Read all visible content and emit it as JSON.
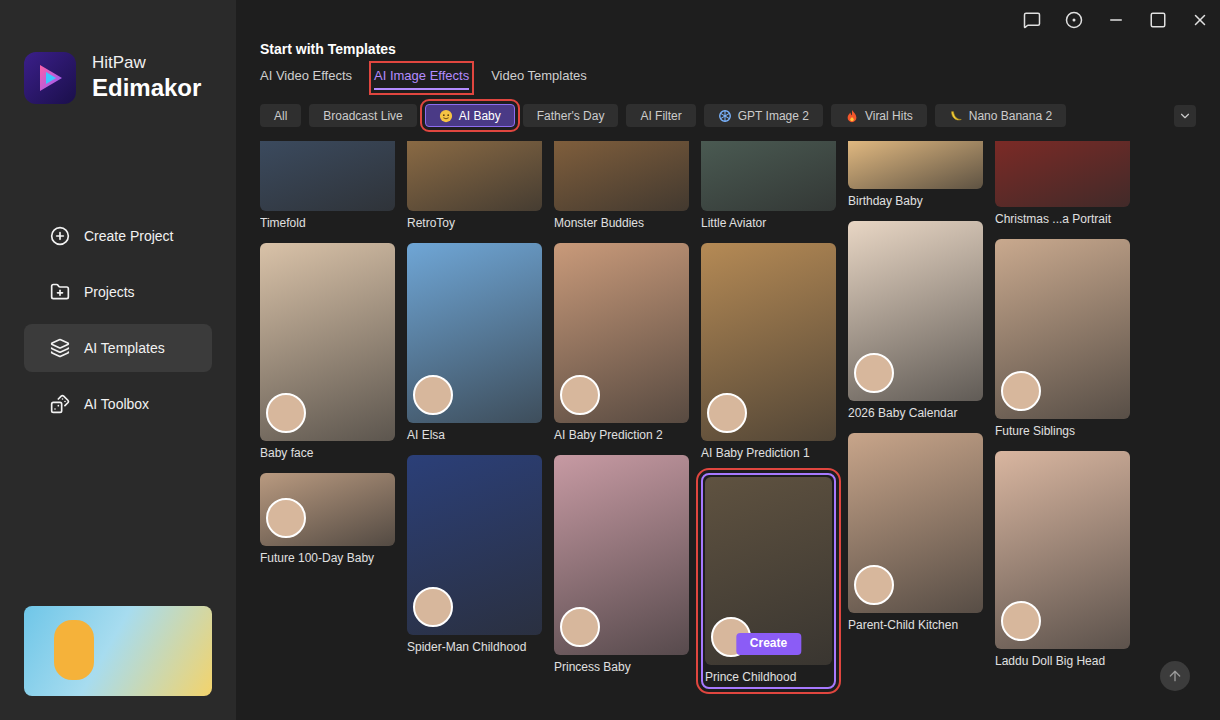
{
  "app": {
    "brand": "HitPaw",
    "product": "Edimakor"
  },
  "sidebar": {
    "items": [
      {
        "label": "Create Project",
        "selected": false
      },
      {
        "label": "Projects",
        "selected": false
      },
      {
        "label": "AI Templates",
        "selected": true
      },
      {
        "label": "AI Toolbox",
        "selected": false
      }
    ]
  },
  "heading": "Start with Templates",
  "tabs": [
    {
      "label": "AI Video Effects",
      "selected": false,
      "annotated": false
    },
    {
      "label": "AI Image Effects",
      "selected": true,
      "annotated": true
    },
    {
      "label": "Video Templates",
      "selected": false,
      "annotated": false
    }
  ],
  "categories": [
    {
      "label": "All",
      "kind": "plain",
      "selected": false,
      "annotated": false
    },
    {
      "label": "Broadcast Live",
      "kind": "plain",
      "selected": false,
      "annotated": false
    },
    {
      "label": "AI Baby",
      "kind": "baby",
      "selected": true,
      "annotated": true
    },
    {
      "label": "Father's Day",
      "kind": "plain",
      "selected": false,
      "annotated": false
    },
    {
      "label": "AI Filter",
      "kind": "plain",
      "selected": false,
      "annotated": false
    },
    {
      "label": "GPT Image 2",
      "kind": "gpt",
      "selected": false,
      "annotated": false
    },
    {
      "label": "Viral Hits",
      "kind": "fire",
      "selected": false,
      "annotated": false
    },
    {
      "label": "Nano Banana 2",
      "kind": "banana",
      "selected": false,
      "annotated": false
    }
  ],
  "columns": [
    [
      {
        "label": "Timefold",
        "selected": false,
        "annotated": false
      },
      {
        "label": "Baby face",
        "selected": false,
        "annotated": false
      },
      {
        "label": "Future 100-Day Baby",
        "selected": false,
        "annotated": false
      }
    ],
    [
      {
        "label": "RetroToy",
        "selected": false,
        "annotated": false
      },
      {
        "label": "AI Elsa",
        "selected": false,
        "annotated": false
      },
      {
        "label": "Spider-Man Childhood",
        "selected": false,
        "annotated": false
      }
    ],
    [
      {
        "label": "Monster Buddies",
        "selected": false,
        "annotated": false
      },
      {
        "label": "AI Baby Prediction 2",
        "selected": false,
        "annotated": false
      },
      {
        "label": "Princess Baby",
        "selected": false,
        "annotated": false
      }
    ],
    [
      {
        "label": "Little Aviator",
        "selected": false,
        "annotated": false
      },
      {
        "label": "AI Baby Prediction 1",
        "selected": false,
        "annotated": false
      },
      {
        "label": "Prince Childhood",
        "selected": true,
        "annotated": true,
        "action": "Create"
      }
    ],
    [
      {
        "label": "Birthday Baby",
        "selected": false,
        "annotated": false
      },
      {
        "label": "2026 Baby Calendar",
        "selected": false,
        "annotated": false
      },
      {
        "label": "Parent-Child Kitchen",
        "selected": false,
        "annotated": false
      }
    ],
    [
      {
        "label": "Christmas ...a Portrait",
        "selected": false,
        "annotated": false
      },
      {
        "label": "Future Siblings",
        "selected": false,
        "annotated": false
      },
      {
        "label": "Laddu Doll Big Head",
        "selected": false,
        "annotated": false
      }
    ]
  ]
}
